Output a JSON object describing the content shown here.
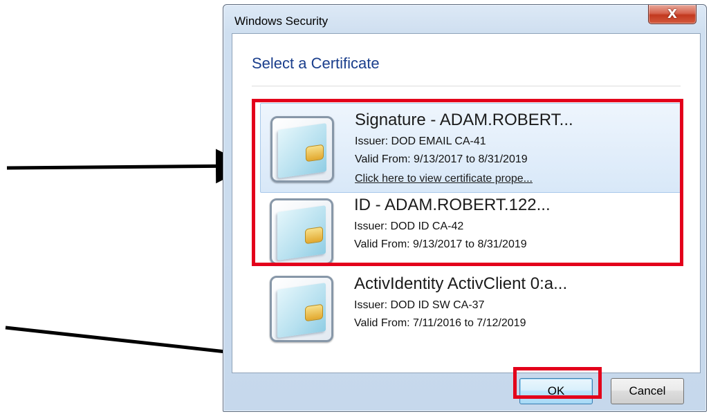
{
  "window": {
    "title": "Windows Security",
    "close_glyph": "X",
    "heading": "Select a Certificate"
  },
  "certificates": [
    {
      "name": "Signature - ADAM.ROBERT...",
      "issuer": "Issuer: DOD EMAIL CA-41",
      "valid": "Valid From: 9/13/2017 to 8/31/2019",
      "link": "Click here to view certificate prope...",
      "selected": true
    },
    {
      "name": "ID -  ADAM.ROBERT.122...",
      "issuer": "Issuer: DOD ID CA-42",
      "valid": "Valid From: 9/13/2017 to 8/31/2019"
    },
    {
      "name": "ActivIdentity ActivClient 0:a...",
      "issuer": "Issuer: DOD ID SW CA-37",
      "valid": "Valid From: 7/11/2016 to 7/12/2019"
    }
  ],
  "buttons": {
    "ok": "OK",
    "cancel": "Cancel"
  },
  "icons": {
    "certificate": "smart-card-icon",
    "close": "close-icon"
  },
  "colors": {
    "highlight": "#e3001b",
    "heading": "#1a3e8c",
    "arrow": "#000000"
  }
}
